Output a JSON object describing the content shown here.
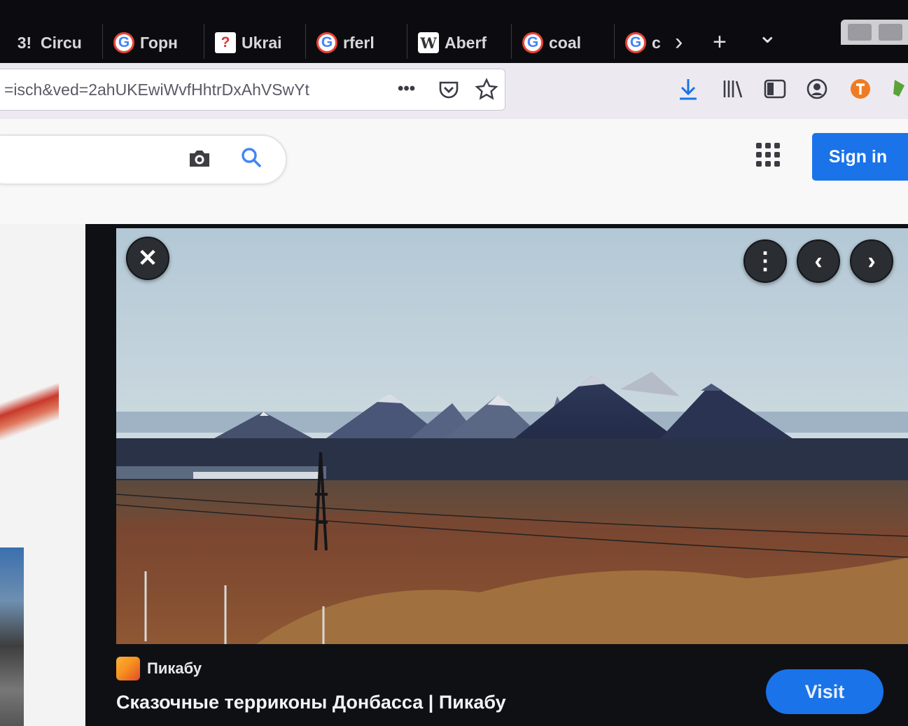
{
  "tabs": [
    {
      "favicon_text": "3!",
      "favicon": "text-favicon",
      "label": "Circu"
    },
    {
      "favicon_text": "G",
      "favicon": "google-favicon",
      "label": "Горн"
    },
    {
      "favicon_text": "?",
      "favicon": "yellow-favicon",
      "label": "Ukrai"
    },
    {
      "favicon_text": "G",
      "favicon": "google-favicon",
      "label": "rferl"
    },
    {
      "favicon_text": "W",
      "favicon": "wikipedia-favicon",
      "label": "Aberf"
    },
    {
      "favicon_text": "G",
      "favicon": "google-favicon",
      "label": "coal"
    },
    {
      "favicon_text": "G",
      "favicon": "google-favicon",
      "label": "c"
    }
  ],
  "tab_controls": {
    "scroll": "›",
    "new_tab": "+",
    "list": "⌄"
  },
  "url": {
    "text": "=isch&ved=2ahUKEwiWvfHhtrDxAhVSwYt",
    "more": "•••"
  },
  "icons": {
    "pocket": "pocket-icon",
    "bookmark": "star-icon",
    "download": "download-icon",
    "library": "library-icon",
    "sidebar": "sidebar-icon",
    "account": "account-icon",
    "extension": "extension-icon"
  },
  "header": {
    "sign_in": "Sign in"
  },
  "viewer": {
    "close": "✕",
    "more": "⋮",
    "prev": "‹",
    "next": "›",
    "source_name": "Пикабу",
    "title": "Сказочные терриконы Донбасса | Пикабу",
    "visit": "Visit"
  },
  "colors": {
    "accent": "#1a73e8",
    "tabstrip": "#0c0c10",
    "viewer_bg": "#0f1014"
  }
}
